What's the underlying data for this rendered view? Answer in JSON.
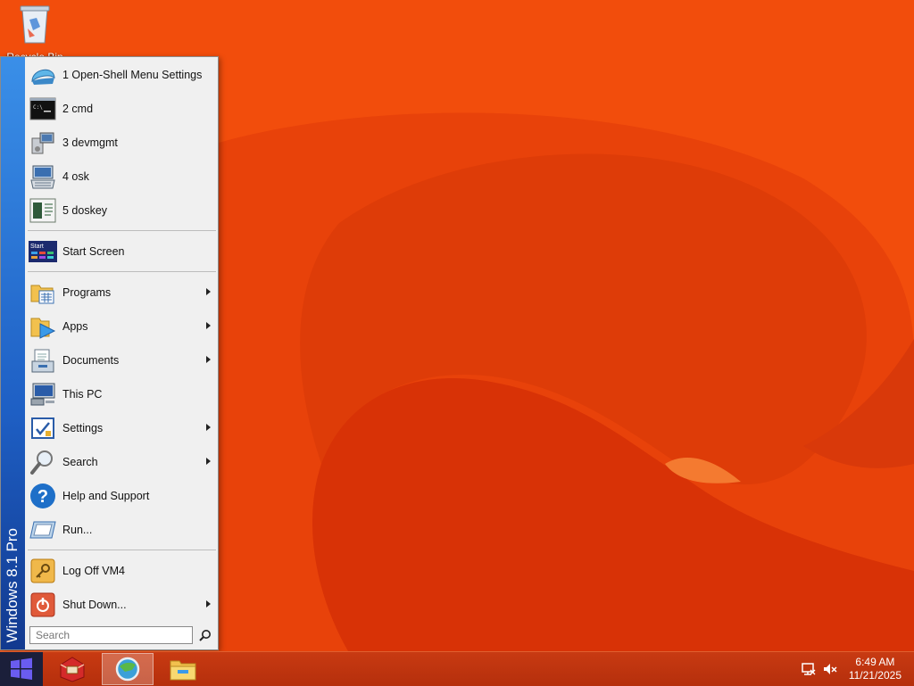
{
  "desktop": {
    "recycle_bin_label": "Recycle Bin"
  },
  "start_menu": {
    "banner": "Windows 8.1 Pro",
    "recent": [
      {
        "label": "1 Open-Shell Menu Settings"
      },
      {
        "label": "2 cmd"
      },
      {
        "label": "3 devmgmt"
      },
      {
        "label": "4 osk"
      },
      {
        "label": "5 doskey"
      }
    ],
    "start_screen": "Start Screen",
    "main": [
      {
        "label": "Programs",
        "has_submenu": true
      },
      {
        "label": "Apps",
        "has_submenu": true
      },
      {
        "label": "Documents",
        "has_submenu": true
      },
      {
        "label": "This PC",
        "has_submenu": false
      },
      {
        "label": "Settings",
        "has_submenu": true
      },
      {
        "label": "Search",
        "has_submenu": true
      },
      {
        "label": "Help and Support",
        "has_submenu": false
      },
      {
        "label": "Run...",
        "has_submenu": false
      }
    ],
    "log_off": "Log Off VM4",
    "shut_down": "Shut Down...",
    "search_placeholder": "Search"
  },
  "taskbar": {
    "time": "6:49 AM",
    "date": "11/21/2025"
  },
  "colors": {
    "wallpaper": "#f04a0a",
    "banner": "#1e5fc4",
    "taskbar": "#c03510"
  }
}
